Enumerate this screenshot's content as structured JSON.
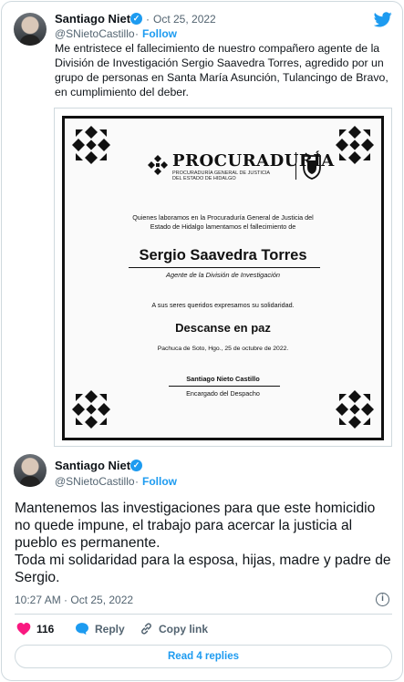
{
  "quoted_tweet": {
    "author_name": "Santiago Nieto",
    "handle": "@SNietoCastillo",
    "date_sep": "·",
    "date": "Oct 25, 2022",
    "follow_label": "Follow",
    "text": "Me entristece el fallecimiento de nuestro compañero agente de la División de Investigación Sergio Saavedra Torres, agredido por un grupo de personas en Santa María Asunción, Tulancingo de Bravo, en cumplimiento del deber."
  },
  "card": {
    "brand_title": "PROCURADURÍA",
    "brand_sub": "PROCURADURÍA GENERAL DE JUSTICIA DEL ESTADO DE HIDALGO",
    "intro_line1": "Quienes laboramos en la Procuraduría General de Justicia del",
    "intro_line2": "Estado de Hidalgo lamentamos el fallecimiento de",
    "deceased_name": "Sergio Saavedra Torres",
    "deceased_role": "Agente de la División de Investigación",
    "solidarity": "A sus seres queridos expresamos su solidaridad.",
    "rest_in_peace": "Descanse en paz",
    "place_date": "Pachuca de Soto, Hgo., 25 de octubre de 2022.",
    "signer_name": "Santiago Nieto Castillo",
    "signer_role": "Encargado del Despacho"
  },
  "main_tweet": {
    "author_name": "Santiago Nieto",
    "handle": "@SNietoCastillo",
    "date_sep": "·",
    "follow_label": "Follow",
    "text_line1": "Mantenemos las investigaciones para que este homicidio no quede impune, el trabajo para acercar la justicia al pueblo es permanente.",
    "text_line2": "Toda mi solidaridad para la esposa, hijas, madre y padre de Sergio.",
    "timestamp": "10:27 AM · Oct 25, 2022",
    "likes": "116",
    "reply_label": "Reply",
    "copy_link_label": "Copy link",
    "read_replies_label": "Read 4 replies"
  },
  "colors": {
    "accent": "#1d9bf0",
    "like": "#f91880",
    "muted": "#536471",
    "border": "#cfd9de"
  },
  "icons": [
    "verified-badge-icon",
    "twitter-bird-icon",
    "heart-icon",
    "reply-bubble-icon",
    "link-icon",
    "info-icon",
    "ornament-icon",
    "coat-of-arms-icon"
  ]
}
